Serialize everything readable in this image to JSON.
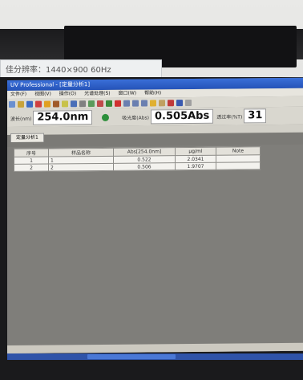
{
  "sticker": {
    "text": "佳分辨率：1440×900 60Hz"
  },
  "window": {
    "title": "UV Professional - [定量分析1]"
  },
  "menu": [
    "文件(F)",
    "视图(V)",
    "操作(O)",
    "光谱处理(S)",
    "窗口(W)",
    "帮助(H)"
  ],
  "readout": {
    "wavelength_label": "波长(nm)",
    "wavelength_value": "254.0nm",
    "abs_label": "吸光度(Abs)",
    "abs_value": "0.505Abs",
    "trans_label": "透过率(%T)",
    "trans_value": "31"
  },
  "tab": {
    "label": "定量分析1"
  },
  "table": {
    "headers": [
      "序号",
      "样品名称",
      "Abs[254.0nm]",
      "μg/ml",
      "Note"
    ],
    "rows": [
      [
        "1",
        "1",
        "0.522",
        "2.0341",
        ""
      ],
      [
        "2",
        "2",
        "0.506",
        "1.9707",
        ""
      ]
    ]
  },
  "colors": {
    "titlebar": "#2553b8",
    "screen": "#7b7a76",
    "accent_green": "#2c8f3a"
  }
}
